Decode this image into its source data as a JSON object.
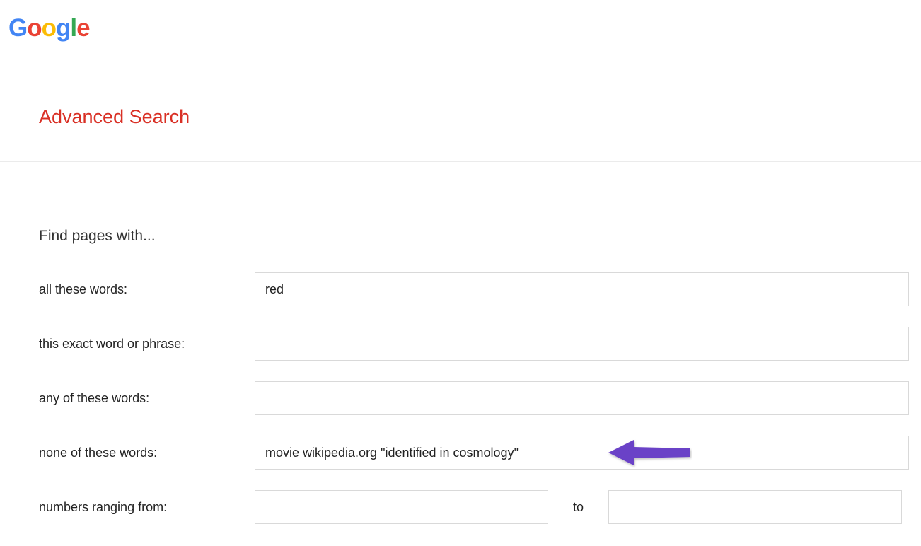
{
  "logo": {
    "g1": "G",
    "o1": "o",
    "o2": "o",
    "g2": "g",
    "l": "l",
    "e": "e"
  },
  "pageTitle": "Advanced Search",
  "sectionTitle": "Find pages with...",
  "fields": {
    "allWords": {
      "label": "all these words:",
      "value": "red"
    },
    "exactPhrase": {
      "label": "this exact word or phrase:",
      "value": ""
    },
    "anyWords": {
      "label": "any of these words:",
      "value": ""
    },
    "noneWords": {
      "label": "none of these words:",
      "value": "movie wikipedia.org \"identified in cosmology\""
    },
    "numbersRange": {
      "label": "numbers ranging from:",
      "fromValue": "",
      "toLabel": "to",
      "toValue": ""
    }
  }
}
